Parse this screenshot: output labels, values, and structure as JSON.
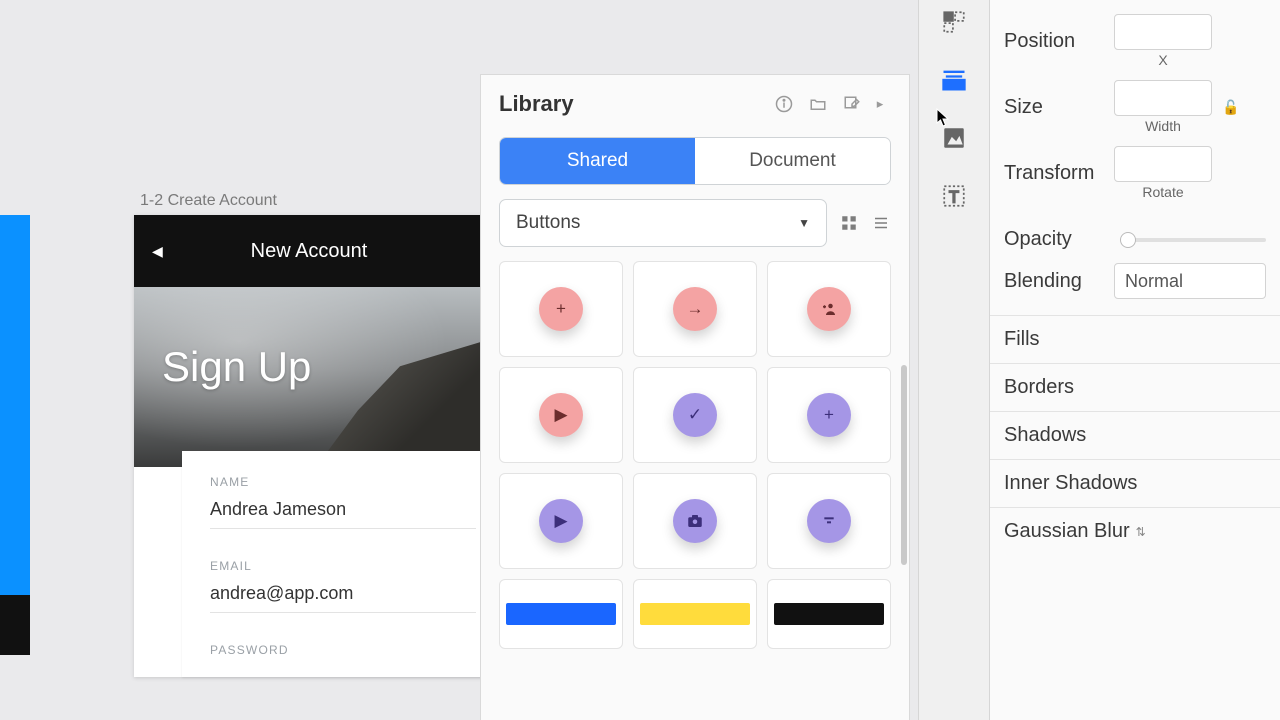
{
  "artboard": {
    "label": "1-2 Create Account",
    "header_title": "New Account",
    "hero_title": "Sign Up",
    "fields": {
      "name_label": "NAME",
      "name_value": "Andrea Jameson",
      "email_label": "EMAIL",
      "email_value": "andrea@app.com",
      "password_label": "PASSWORD"
    }
  },
  "library": {
    "title": "Library",
    "tabs": {
      "shared": "Shared",
      "document": "Document"
    },
    "dropdown": "Buttons"
  },
  "inspector": {
    "position_label": "Position",
    "position_x": "X",
    "size_label": "Size",
    "size_width": "Width",
    "transform_label": "Transform",
    "transform_rotate": "Rotate",
    "opacity_label": "Opacity",
    "blending_label": "Blending",
    "blending_value": "Normal",
    "fills": "Fills",
    "borders": "Borders",
    "shadows": "Shadows",
    "inner_shadows": "Inner Shadows",
    "gaussian_blur": "Gaussian Blur"
  }
}
